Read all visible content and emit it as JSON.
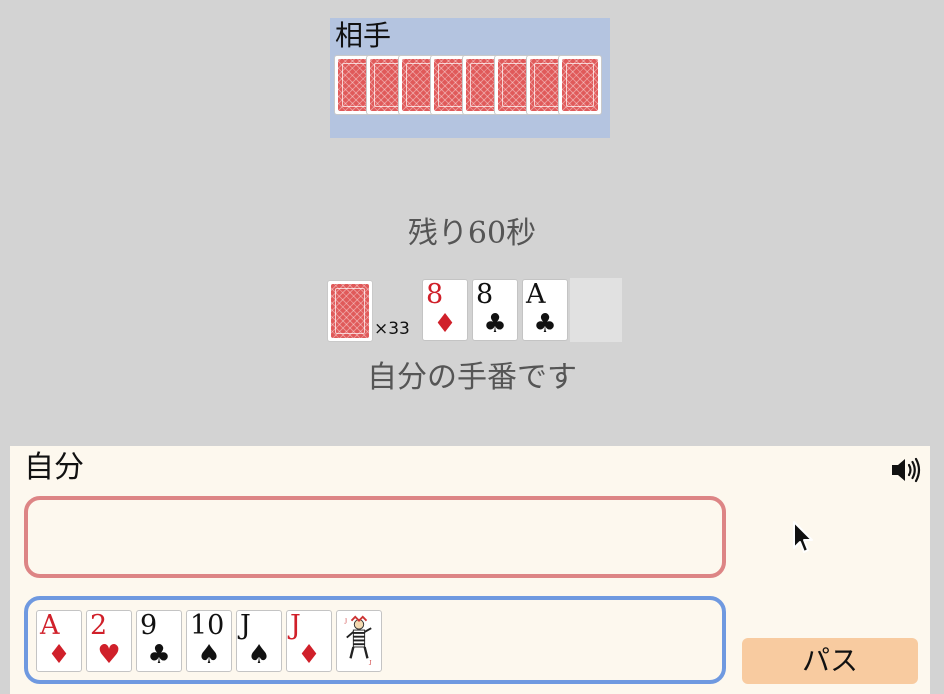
{
  "opponent": {
    "label": "相手",
    "hand_count": 8
  },
  "timer": {
    "text": "残り60秒"
  },
  "deck": {
    "count_label": "×33"
  },
  "field": {
    "cards": [
      {
        "rank": "8",
        "suit": "♦",
        "color": "red"
      },
      {
        "rank": "8",
        "suit": "♣",
        "color": "black"
      },
      {
        "rank": "A",
        "suit": "♣",
        "color": "black"
      }
    ]
  },
  "status": {
    "text": "自分の手番です"
  },
  "player": {
    "label": "自分",
    "hand": [
      {
        "rank": "A",
        "suit": "♦",
        "color": "red"
      },
      {
        "rank": "2",
        "suit": "♥",
        "color": "red"
      },
      {
        "rank": "9",
        "suit": "♣",
        "color": "black"
      },
      {
        "rank": "10",
        "suit": "♠",
        "color": "black"
      },
      {
        "rank": "J",
        "suit": "♠",
        "color": "black"
      },
      {
        "rank": "J",
        "suit": "♦",
        "color": "red"
      },
      {
        "rank": "",
        "suit": "",
        "color": "joker"
      }
    ],
    "pass_label": "パス",
    "sound_icon": "speaker-volume-icon"
  },
  "colors": {
    "background": "#d3d3d3",
    "opponent_area": "#b4c4e0",
    "player_area": "#fdf8ee",
    "selected_border": "#dd8585",
    "hand_border": "#6f99e0",
    "pass_button": "#f8cba0",
    "card_back": "#e05a5a",
    "red_suit": "#d0202a"
  }
}
